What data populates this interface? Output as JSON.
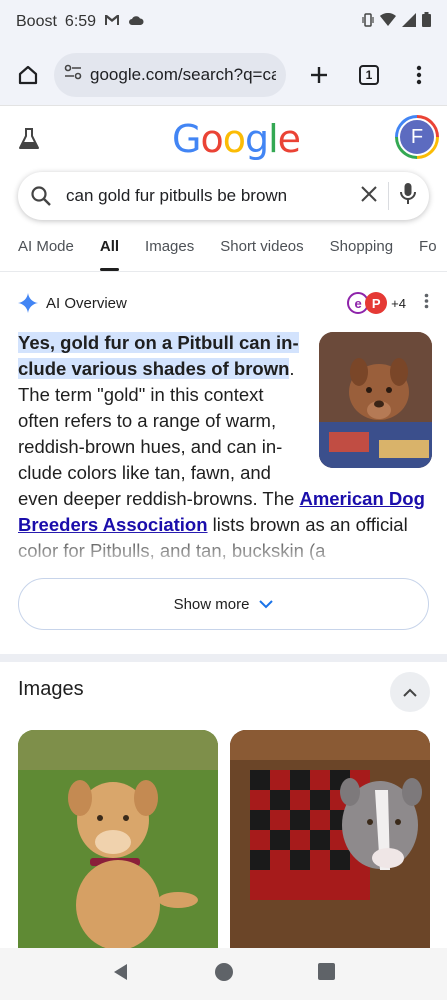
{
  "status_bar": {
    "carrier": "Boost",
    "time": "6:59"
  },
  "browser": {
    "url": "google.com/search?q=ca",
    "tab_count": "1"
  },
  "google": {
    "logo": "Google",
    "avatar_letter": "F",
    "search_query": "can gold fur pitbulls be brown"
  },
  "tabs": [
    {
      "label": "AI Mode"
    },
    {
      "label": "All"
    },
    {
      "label": "Images"
    },
    {
      "label": "Short videos"
    },
    {
      "label": "Shopping"
    },
    {
      "label": "Fo"
    }
  ],
  "ai_overview": {
    "title": "AI Overview",
    "source_badge_a": "e",
    "source_badge_b": "P",
    "source_more": "+4",
    "highlight": "Yes, gold fur on a Pitbull can in­clude various shades of brown",
    "highlight_end": ".",
    "body1": " The term \"gold\" in this context often refers to a range of warm, reddish-brown hues, and can in­clude colors like tan, fawn, and even deeper reddish-browns. The ",
    "link": "American Dog Breeders Association",
    "body2": " lists brown as an official color for Pitbulls, and tan, buckskin (a",
    "show_more": "Show more"
  },
  "images_section": {
    "title": "Images"
  },
  "colors": {
    "accent": "#1a73e8",
    "highlight": "#d3e3fd",
    "link": "#1a0dab",
    "google_blue": "#4285f4",
    "google_red": "#ea4335",
    "google_yellow": "#fbbc05",
    "google_green": "#34a853"
  }
}
